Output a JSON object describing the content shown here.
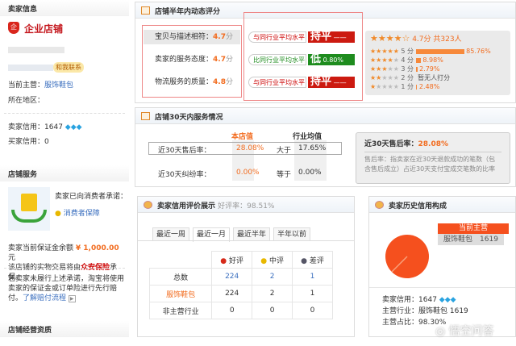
{
  "sidebar": {
    "seller_info_title": "卖家信息",
    "shop_type": "企业店铺",
    "contact_badge": "和我联系",
    "main_business_label": "当前主营：",
    "main_business": "服饰鞋包",
    "region_label": "所在地区：",
    "seller_credit_label": "卖家信用：",
    "seller_credit": "1647",
    "buyer_credit_label": "买家信用：",
    "buyer_credit": "0",
    "shop_service_title": "店铺服务",
    "promise_text": "卖家已向消费者承诺：",
    "consumer_guarantee": "消费者保障",
    "deposit_prefix": "卖家当前保证金余额",
    "deposit_amount": "¥ 1,000.00",
    "deposit_suffix": "元",
    "insurance_prefix": "该店铺的实物交易将由",
    "insurance_name": "众安保险",
    "insurance_suffix": "承保。",
    "compensation_text": "若卖家未履行上述承诺，淘宝将使用卖家的保证金或订单险进行先行赔付。",
    "compensation_link": "了解赔付流程",
    "qualification_title": "店铺经营资质"
  },
  "rating_panel": {
    "title": "店铺半年内动态评分",
    "items": [
      {
        "label": "宝贝与描述相符：",
        "score": "4.7",
        "unit": "分",
        "compare": "与同行业平均水平",
        "level": "持平",
        "pct": "——"
      },
      {
        "label": "卖家的服务态度：",
        "score": "4.7",
        "unit": "分",
        "compare": "比同行业平均水平",
        "level": "低",
        "pct": "0.80%"
      },
      {
        "label": "物流服务的质量：",
        "score": "4.8",
        "unit": "分",
        "compare": "与同行业平均水平",
        "level": "持平",
        "pct": "——"
      }
    ],
    "summary": "4.7分 共323人",
    "star_rating": 4.7,
    "distribution": [
      {
        "label": "5 分",
        "pct": "85.76%",
        "value": 85.76
      },
      {
        "label": "4 分",
        "pct": "8.98%",
        "value": 8.98
      },
      {
        "label": "3 分",
        "pct": "2.79%",
        "value": 2.79
      },
      {
        "label": "2 分",
        "pct": "暂无人打分",
        "value": 0
      },
      {
        "label": "1 分",
        "pct": "2.48%",
        "value": 2.48
      }
    ],
    "colors": {
      "level_equal": "#cc1a10",
      "level_low": "#1e8c1e",
      "accent": "#f26c1f"
    }
  },
  "service_panel": {
    "title": "店铺30天内服务情况",
    "col_shop": "本店值",
    "col_industry": "行业均值",
    "rows": [
      {
        "label": "近30天售后率：",
        "shop": "28.08%",
        "cmp": "大于",
        "industry": "17.65%"
      },
      {
        "label": "近30天纠纷率：",
        "shop": "0.00%",
        "cmp": "等于",
        "industry": "0.00%"
      }
    ],
    "tip_title": "近30天售后率：",
    "tip_value": "28.08%",
    "tip_text": "售后率：指卖家在近30天退款成功的笔数（包含售后成立）占近30天支付宝成交笔数的比率"
  },
  "review_panel": {
    "title": "卖家信用评价展示",
    "good_rate": "好评率：98.51%",
    "tabs": [
      "最近一周",
      "最近一月",
      "最近半年",
      "半年以前"
    ],
    "active_tab": 1,
    "headers": [
      "好评",
      "中评",
      "差评"
    ],
    "rows": [
      {
        "label": "总数",
        "values": [
          "224",
          "2",
          "1"
        ]
      },
      {
        "label": "服饰鞋包",
        "values": [
          "224",
          "2",
          "1"
        ]
      },
      {
        "label": "非主营行业",
        "values": [
          "0",
          "0",
          "0"
        ]
      }
    ]
  },
  "history_panel": {
    "title": "卖家历史信用构成",
    "callout_title": "当前主营",
    "callout_value": "服饰鞋包　1619",
    "credit_label": "卖家信用：",
    "credit": "1647",
    "industry_label": "主营行业：",
    "industry": "服饰鞋包 1619",
    "share_label": "主营占比：",
    "share": "98.30%",
    "pie_color": "#f5501e"
  },
  "watermark": "悟空问答"
}
